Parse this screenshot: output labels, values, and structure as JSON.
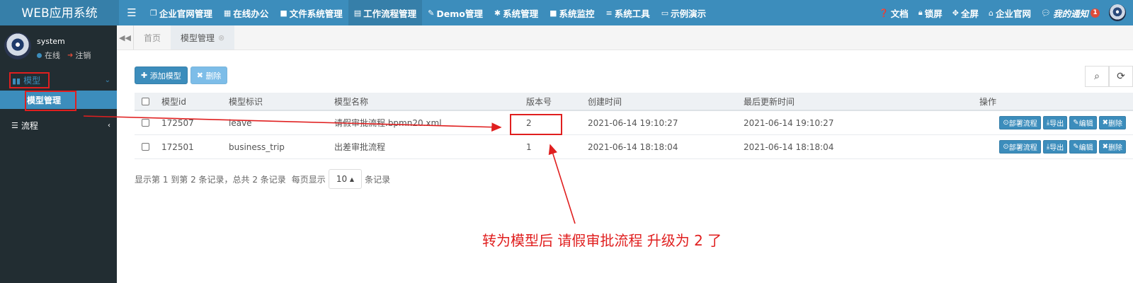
{
  "app": {
    "title": "WEB应用系统"
  },
  "topnav": [
    {
      "icon": "copy-icon",
      "glyph": "❐",
      "label": "企业官网管理"
    },
    {
      "icon": "keyboard-icon",
      "glyph": "▦",
      "label": "在线办公"
    },
    {
      "icon": "folder-icon",
      "glyph": "■",
      "label": "文件系统管理"
    },
    {
      "icon": "workflow-icon",
      "glyph": "▤",
      "label": "工作流程管理"
    },
    {
      "icon": "edit-icon",
      "glyph": "✎",
      "label": "Demo管理"
    },
    {
      "icon": "gear-icon",
      "glyph": "✱",
      "label": "系统管理"
    },
    {
      "icon": "video-icon",
      "glyph": "■",
      "label": "系统监控"
    },
    {
      "icon": "list-icon",
      "glyph": "≡",
      "label": "系统工具"
    },
    {
      "icon": "monitor-icon",
      "glyph": "▭",
      "label": "示例演示"
    }
  ],
  "topright": {
    "docs": "文档",
    "lock": "锁屏",
    "fullscreen": "全屏",
    "site": "企业官网",
    "notice": "我的通知",
    "notice_count": "1"
  },
  "user": {
    "name": "system",
    "status": "在线",
    "logout": "注销"
  },
  "sidebar": {
    "model_label": "模型",
    "model_sub": "模型管理",
    "process_label": "流程"
  },
  "tabs": {
    "home": "首页",
    "current": "模型管理"
  },
  "toolbar": {
    "add": "添加模型",
    "delete": "删除"
  },
  "table": {
    "headers": {
      "id": "模型id",
      "key": "模型标识",
      "name": "模型名称",
      "version": "版本号",
      "created": "创建时间",
      "updated": "最后更新时间",
      "ops": "操作"
    },
    "rows": [
      {
        "id": "172507",
        "key": "leave",
        "name": "请假审批流程.bpmn20.xml",
        "version": "2",
        "created": "2021-06-14 19:10:27",
        "updated": "2021-06-14 19:10:27"
      },
      {
        "id": "172501",
        "key": "business_trip",
        "name": "出差审批流程",
        "version": "1",
        "created": "2021-06-14 18:18:04",
        "updated": "2021-06-14 18:18:04"
      }
    ],
    "ops": {
      "deploy": "部署流程",
      "export": "导出",
      "edit": "编辑",
      "delete": "删除"
    }
  },
  "pager": {
    "summary": "显示第 1 到第 2 条记录，总共 2 条记录",
    "per_page_prefix": "每页显示",
    "page_size": "10",
    "per_page_suffix": "条记录"
  },
  "annotation": {
    "text": "转为模型后 请假审批流程 升级为 2 了",
    "color": "#e01f1f"
  },
  "colors": {
    "primary": "#3c8dbc",
    "sidebar": "#222d32",
    "annotation": "#e01f1f"
  }
}
